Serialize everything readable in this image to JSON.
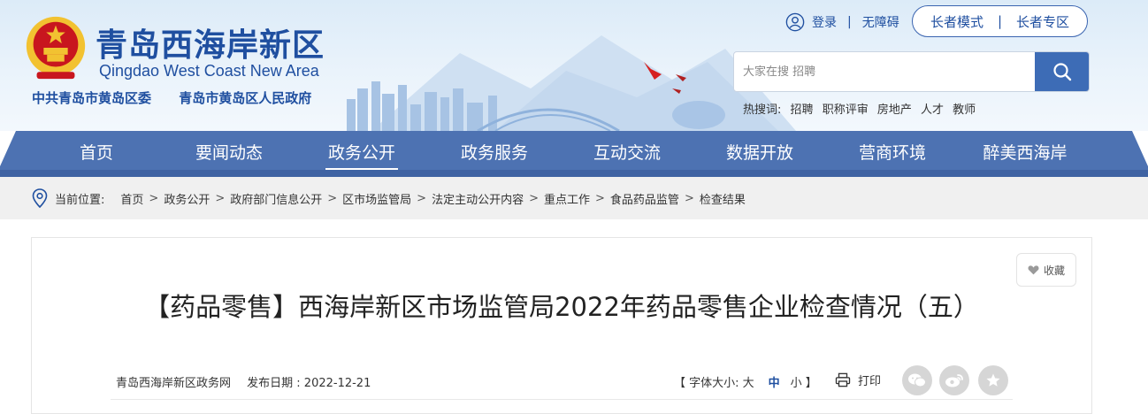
{
  "header": {
    "site_name_cn": "青岛西海岸新区",
    "site_name_en": "Qingdao West Coast New Area",
    "org_party": "中共青岛市黄岛区委",
    "org_gov": "青岛市黄岛区人民政府",
    "login": "登录",
    "accessibility": "无障碍",
    "elder_mode": "长者模式",
    "elder_zone": "长者专区",
    "search_placeholder": "大家在搜 招聘",
    "hot_label": "热搜词:",
    "hot_terms": [
      "招聘",
      "职称评审",
      "房地产",
      "人才",
      "教师"
    ]
  },
  "nav": {
    "items": [
      "首页",
      "要闻动态",
      "政务公开",
      "政务服务",
      "互动交流",
      "数据开放",
      "营商环境",
      "醉美西海岸"
    ],
    "active": "政务公开"
  },
  "breadcrumb": {
    "label": "当前位置:",
    "items": [
      "首页",
      "政务公开",
      "政府部门信息公开",
      "区市场监管局",
      "法定主动公开内容",
      "重点工作",
      "食品药品监管",
      "检查结果"
    ]
  },
  "article": {
    "favorite": "收藏",
    "title": "【药品零售】西海岸新区市场监管局2022年药品零售企业检查情况（五）",
    "source": "青岛西海岸新区政务网",
    "publish_label": "发布日期 : 2022-12-21",
    "font_size_label": "【 字体大小: 大",
    "font_mid": "中",
    "font_small": "小 】",
    "print": "打印"
  },
  "colors": {
    "primary": "#1f4fa0",
    "nav": "#4d72b2",
    "search_button": "#3d6cb6",
    "emblem_red": "#c8161e"
  },
  "icons": [
    "user-icon",
    "search-icon",
    "location-pin-icon",
    "heart-icon",
    "print-icon",
    "wechat-icon",
    "weibo-icon",
    "star-icon"
  ]
}
